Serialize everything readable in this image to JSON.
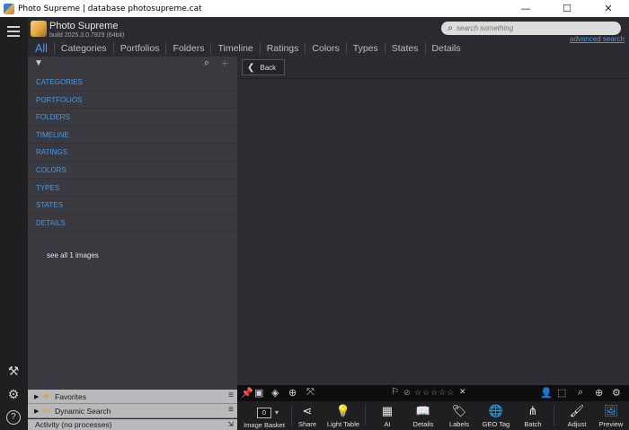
{
  "window": {
    "title": "Photo Supreme | database photosupreme.cat",
    "minimize": "—",
    "maximize": "☐",
    "close": "✕"
  },
  "app": {
    "name": "Photo Supreme",
    "build": "build 2025.3.0.7929 (64bit)"
  },
  "search": {
    "placeholder": "search something",
    "advanced": "advanced search"
  },
  "tabs": [
    "All",
    "Categories",
    "Portfolios",
    "Folders",
    "Timeline",
    "Ratings",
    "Colors",
    "Types",
    "States",
    "Details"
  ],
  "categories": [
    "CATEGORIES",
    "PORTFOLIOS",
    "FOLDERS",
    "TIMELINE",
    "RATINGS",
    "COLORS",
    "TYPES",
    "STATES",
    "DETAILS"
  ],
  "see_all": "see all 1 images",
  "panels": {
    "favorites": "Favorites",
    "dynamic_search": "Dynamic Search",
    "activity": "Activity (no processes)"
  },
  "back_label": "Back",
  "basket_count": "0",
  "actions": {
    "image_basket": "Image Basket",
    "share": "Share",
    "light_table": "Light Table",
    "ai": "AI",
    "details": "Details",
    "labels": "Labels",
    "geo_tag": "GEO Tag",
    "batch": "Batch",
    "adjust": "Adjust",
    "preview": "Preview"
  },
  "colors": {
    "accent": "#4a9ae0",
    "panel": "#3a393f",
    "background": "#2b2a30"
  }
}
